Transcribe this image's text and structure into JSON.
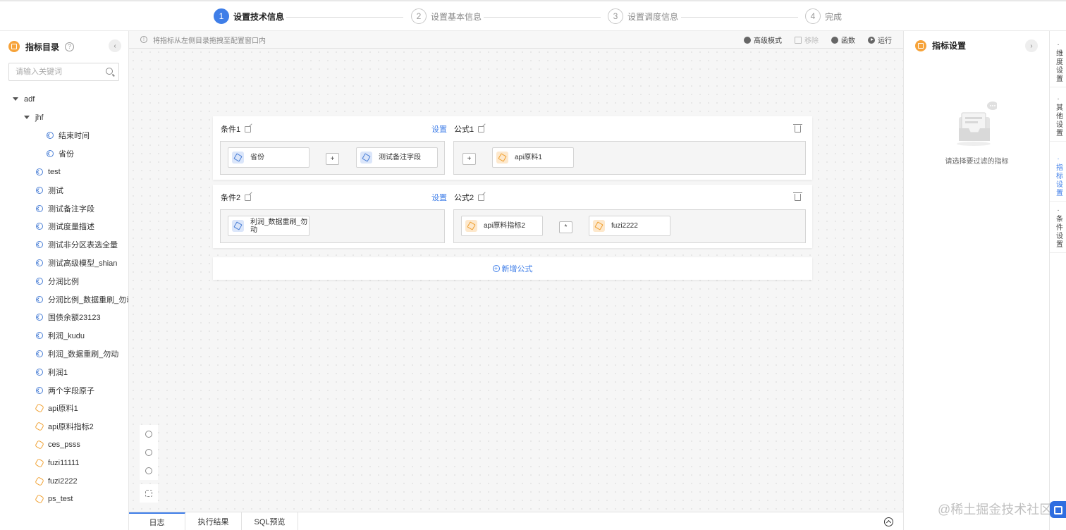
{
  "stepper": {
    "steps": [
      {
        "num": "1",
        "label": "设置技术信息"
      },
      {
        "num": "2",
        "label": "设置基本信息"
      },
      {
        "num": "3",
        "label": "设置调度信息"
      },
      {
        "num": "4",
        "label": "完成"
      }
    ],
    "active_step": 1
  },
  "sidebar": {
    "title": "指标目录",
    "search_placeholder": "请输入关键词",
    "tree": [
      {
        "label": "adf",
        "level": 0,
        "type": "folder"
      },
      {
        "label": "jhf",
        "level": 1,
        "type": "folder"
      },
      {
        "label": "结束时间",
        "level": 2,
        "type": "dimension"
      },
      {
        "label": "省份",
        "level": 2,
        "type": "dimension"
      },
      {
        "label": "test",
        "level": 1,
        "type": "dimension"
      },
      {
        "label": "测试",
        "level": 1,
        "type": "dimension"
      },
      {
        "label": "测试备注字段",
        "level": 1,
        "type": "dimension"
      },
      {
        "label": "测试度量描述",
        "level": 1,
        "type": "dimension"
      },
      {
        "label": "测试非分区表选全量",
        "level": 1,
        "type": "dimension"
      },
      {
        "label": "测试高级模型_shian",
        "level": 1,
        "type": "dimension"
      },
      {
        "label": "分润比例",
        "level": 1,
        "type": "dimension"
      },
      {
        "label": "分润比例_数据重刷_勿动",
        "level": 1,
        "type": "dimension"
      },
      {
        "label": "国债余额23123",
        "level": 1,
        "type": "dimension"
      },
      {
        "label": "利润_kudu",
        "level": 1,
        "type": "dimension"
      },
      {
        "label": "利润_数据重刷_勿动",
        "level": 1,
        "type": "dimension"
      },
      {
        "label": "利润1",
        "level": 1,
        "type": "dimension"
      },
      {
        "label": "两个字段原子",
        "level": 1,
        "type": "dimension"
      },
      {
        "label": "api原料1",
        "level": 1,
        "type": "atomic"
      },
      {
        "label": "api原料指标2",
        "level": 1,
        "type": "atomic"
      },
      {
        "label": "ces_psss",
        "level": 1,
        "type": "atomic"
      },
      {
        "label": "fuzi11111",
        "level": 1,
        "type": "atomic"
      },
      {
        "label": "fuzi2222",
        "level": 1,
        "type": "atomic"
      },
      {
        "label": "ps_test",
        "level": 1,
        "type": "atomic"
      }
    ]
  },
  "toolbar": {
    "hint": "将指标从左侧目录拖拽至配置窗口内",
    "advanced_mode": "高级模式",
    "remove": "移除",
    "function": "函数",
    "run": "运行"
  },
  "cards": [
    {
      "condition_label": "条件1",
      "set_label": "设置",
      "formula_label": "公式1",
      "condition_items": [
        {
          "label": "省份",
          "type": "dimension"
        },
        {
          "label": "测试备注字段",
          "type": "dimension"
        }
      ],
      "condition_op": "+",
      "formula_op": "+",
      "formula_items": [
        {
          "label": "api原料1",
          "type": "atomic"
        }
      ]
    },
    {
      "condition_label": "条件2",
      "set_label": "设置",
      "formula_label": "公式2",
      "condition_items": [
        {
          "label": "利润_数据重刷_勿动",
          "type": "dimension"
        }
      ],
      "formula_op": "*",
      "formula_items": [
        {
          "label": "api原料指标2",
          "type": "atomic"
        },
        {
          "label": "fuzi2222",
          "type": "atomic"
        }
      ]
    }
  ],
  "add_formula": "新增公式",
  "bottom_tabs": [
    "日志",
    "执行结果",
    "SQL预览"
  ],
  "right_panel": {
    "title": "指标设置",
    "empty_text": "请选择要过滤的指标"
  },
  "vertical_tabs": [
    {
      "label": "维度设置",
      "active": false
    },
    {
      "label": "其他设置",
      "active": false
    },
    {
      "label": "指标设置",
      "active": true
    },
    {
      "label": "条件设置",
      "active": false
    }
  ],
  "watermark": "@稀土掘金技术社区",
  "colors": {
    "accent": "#3f7ee8",
    "orange": "#f6a33a",
    "dimension_icon": "#4a7fd6"
  }
}
